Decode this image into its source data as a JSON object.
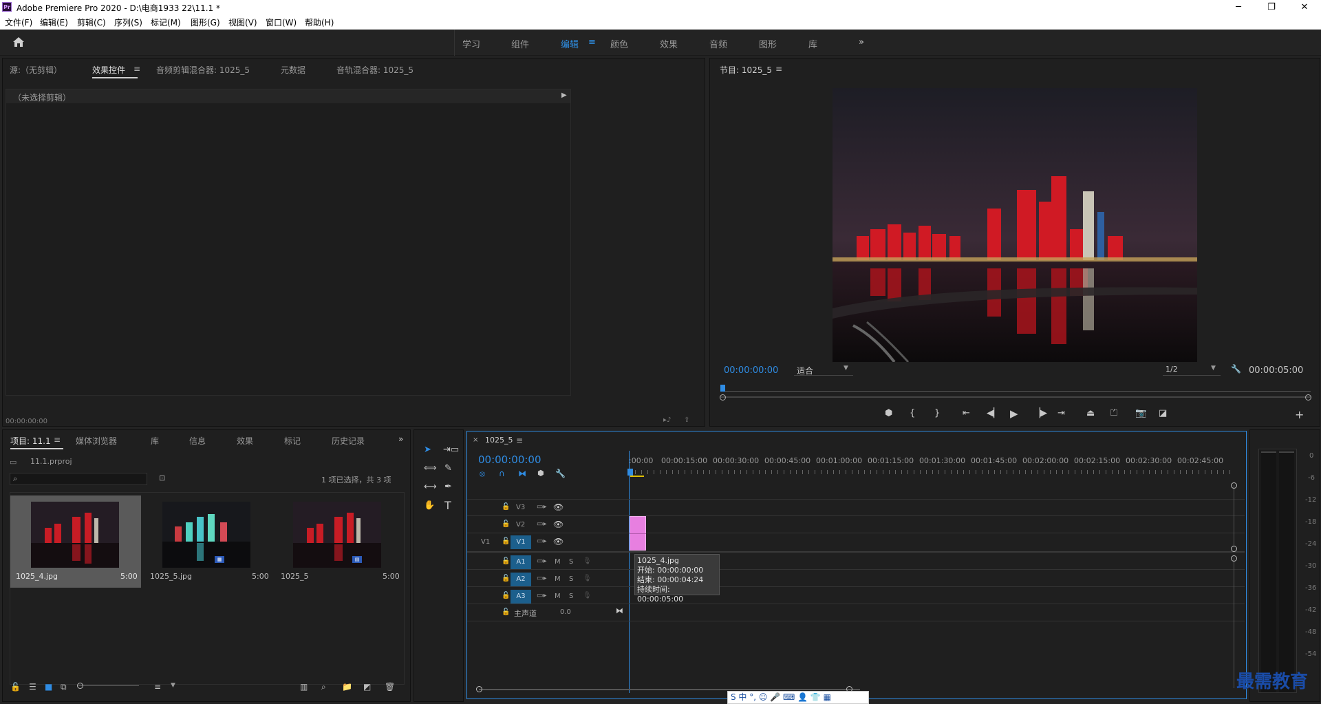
{
  "window": {
    "title": "Adobe Premiere Pro 2020 - D:\\电商1933 22\\11.1 *",
    "app_icon": "Pr",
    "controls": [
      "─",
      "❐",
      "✕"
    ]
  },
  "menu": [
    "文件(F)",
    "编辑(E)",
    "剪辑(C)",
    "序列(S)",
    "标记(M)",
    "图形(G)",
    "视图(V)",
    "窗口(W)",
    "帮助(H)"
  ],
  "workspaces": {
    "items": [
      "学习",
      "组件",
      "编辑",
      "颜色",
      "效果",
      "音频",
      "图形",
      "库"
    ],
    "active": "编辑",
    "more": "»"
  },
  "source_panel": {
    "tabs": [
      "源:（无剪辑）",
      "效果控件",
      "音频剪辑混合器: 1025_5",
      "元数据",
      "音轨混合器: 1025_5"
    ],
    "active_tab": "效果控件",
    "no_clip": "（未选择剪辑）",
    "timecode": "00:00:00:00"
  },
  "program_monitor": {
    "title": "节目: 1025_5",
    "timecode": "00:00:00:00",
    "fit": "适合",
    "resolution": "1/2",
    "duration": "00:00:05:00"
  },
  "project_panel": {
    "tabs": [
      "项目: 11.1",
      "媒体浏览器",
      "库",
      "信息",
      "效果",
      "标记",
      "历史记录"
    ],
    "active_tab": "项目: 11.1",
    "project_file": "11.1.prproj",
    "search_placeholder": "",
    "selection_info": "1 项已选择，共 3 项",
    "items": [
      {
        "name": "1025_4.jpg",
        "duration": "5:00",
        "selected": true
      },
      {
        "name": "1025_5.jpg",
        "duration": "5:00",
        "selected": false
      },
      {
        "name": "1025_5",
        "duration": "5:00",
        "selected": false
      }
    ]
  },
  "timeline": {
    "sequence": "1025_5",
    "timecode": "00:00:00:00",
    "ruler": [
      ":00:00",
      "00:00:15:00",
      "00:00:30:00",
      "00:00:45:00",
      "00:01:00:00",
      "00:01:15:00",
      "00:01:30:00",
      "00:01:45:00",
      "00:02:00:00",
      "00:02:15:00",
      "00:02:30:00",
      "00:02:45:00"
    ],
    "video_tracks": [
      "V3",
      "V2",
      "V1"
    ],
    "source_patch": "V1",
    "audio_tracks": [
      "A1",
      "A2",
      "A3"
    ],
    "mute": "M",
    "solo": "S",
    "master": {
      "label": "主声道",
      "value": "0.0"
    },
    "tooltip": {
      "name": "1025_4.jpg",
      "start": "开始: 00:00:00:00",
      "end": "结束: 00:00:04:24",
      "duration": "持续时间: 00:00:05:00"
    },
    "clip_color": "#e77fe0"
  },
  "meter": {
    "scale": [
      "0",
      "-6",
      "-12",
      "-18",
      "-24",
      "-30",
      "-36",
      "-42",
      "-48",
      "-54"
    ]
  },
  "watermark": "最需教育",
  "ime_bar": "S 中 °, ☺ 🎤 ⌨ 👤 👕 ▦"
}
